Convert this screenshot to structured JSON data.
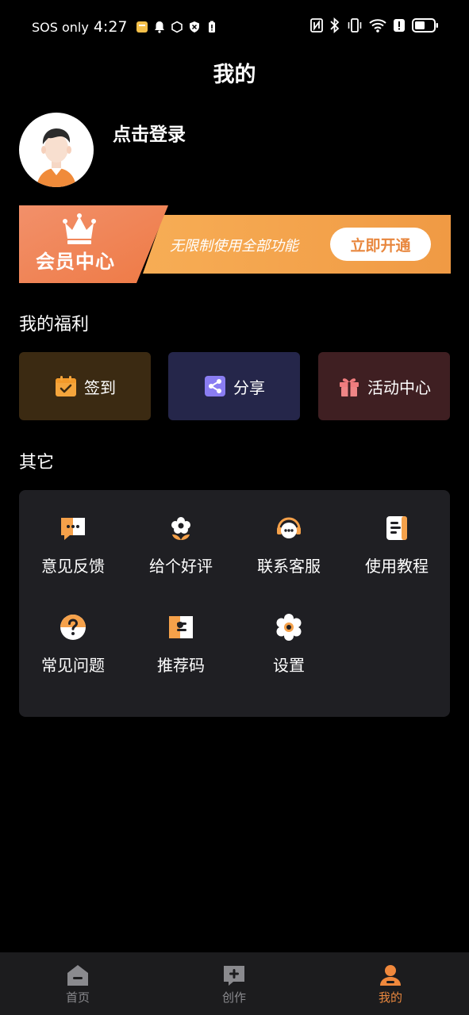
{
  "status_bar": {
    "carrier": "SOS only",
    "time": "4:27"
  },
  "header": {
    "title": "我的"
  },
  "profile": {
    "login_label": "点击登录"
  },
  "vip": {
    "title": "会员中心",
    "slogan": "无限制使用全部功能",
    "open_button": "立即开通"
  },
  "benefits": {
    "title": "我的福利",
    "items": [
      {
        "label": "签到",
        "icon": "calendar-check-icon"
      },
      {
        "label": "分享",
        "icon": "share-icon"
      },
      {
        "label": "活动中心",
        "icon": "gift-icon"
      }
    ]
  },
  "other": {
    "title": "其它",
    "items": [
      {
        "label": "意见反馈",
        "icon": "feedback-icon"
      },
      {
        "label": "给个好评",
        "icon": "flower-icon"
      },
      {
        "label": "联系客服",
        "icon": "headset-icon"
      },
      {
        "label": "使用教程",
        "icon": "document-icon"
      },
      {
        "label": "常见问题",
        "icon": "question-icon"
      },
      {
        "label": "推荐码",
        "icon": "ticket-icon"
      },
      {
        "label": "设置",
        "icon": "gear-icon"
      }
    ]
  },
  "bottom_nav": {
    "items": [
      {
        "label": "首页",
        "icon": "home-icon",
        "active": false
      },
      {
        "label": "创作",
        "icon": "create-icon",
        "active": false
      },
      {
        "label": "我的",
        "icon": "profile-icon",
        "active": true
      }
    ]
  },
  "colors": {
    "accent": "#e8873e",
    "vip_gradient_start": "#f28a5a",
    "vip_gradient_end": "#f2a24c",
    "signin_bg": "#3b2a12",
    "share_bg": "#25264a",
    "activity_bg": "#3f1f22",
    "panel_bg": "#1f1f23",
    "nav_inactive": "#8a8a8e"
  }
}
